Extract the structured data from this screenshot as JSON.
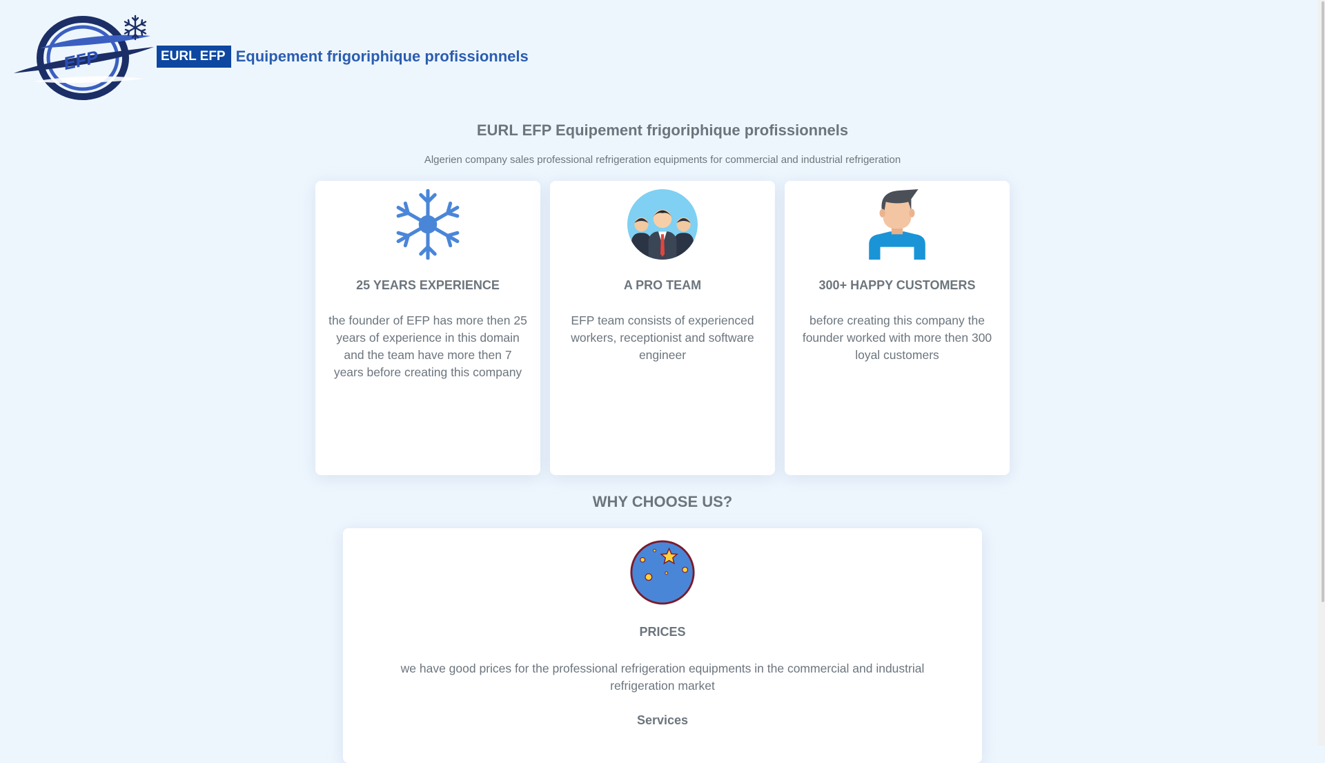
{
  "header": {
    "badge": "EURL EFP",
    "title": "Equipement frigoriphique profissionnels",
    "logo_text": "EFP"
  },
  "hero": {
    "title": "EURL EFP Equipement frigoriphique profissionnels",
    "subtitle": "Algerien company sales professional refrigeration equipments for commercial and industrial refrigeration"
  },
  "features": [
    {
      "icon": "snowflake-icon",
      "title": "25 YEARS EXPERIENCE",
      "text": "the founder of EFP has more then 25 years of experience in this domain and the team have more then 7 years before creating this company"
    },
    {
      "icon": "team-icon",
      "title": "A PRO TEAM",
      "text": "EFP team consists of experienced workers, receptionist and software engineer"
    },
    {
      "icon": "customer-icon",
      "title": "300+ HAPPY CUSTOMERS",
      "text": "before creating this company the founder worked with more then 300 loyal customers"
    }
  ],
  "why": {
    "title": "WHY CHOOSE US?",
    "items": [
      {
        "icon": "globe-star-icon",
        "title": "PRICES",
        "text": "we have good prices for the professional refrigeration equipments in the commercial and industrial refrigeration market"
      }
    ],
    "next_title": "Services"
  },
  "colors": {
    "background": "#eef6fd",
    "brand_blue": "#0d47a1",
    "title_blue": "#2a5db0",
    "text_gray": "#6c757d"
  }
}
